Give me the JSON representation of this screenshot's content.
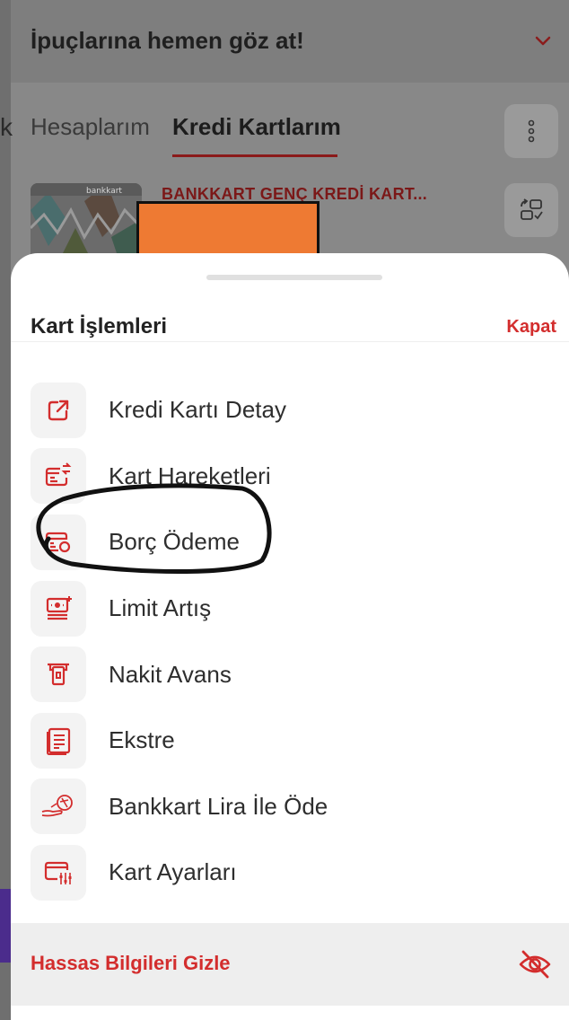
{
  "tips": {
    "title": "İpuçlarına hemen göz at!",
    "chevron_icon": "chevron-down-icon"
  },
  "tabs": [
    {
      "label": "Hesaplarım",
      "active": false
    },
    {
      "label": "Kredi Kartlarım",
      "active": true
    }
  ],
  "card": {
    "name": "BANKKART GENÇ KREDİ KART...",
    "brand_text": "bankkart"
  },
  "sheet": {
    "title": "Kart İşlemleri",
    "close_label": "Kapat",
    "items": [
      {
        "label": "Kredi Kartı Detay",
        "icon": "external-link-icon"
      },
      {
        "label": "Kart Hareketleri",
        "icon": "card-transactions-icon"
      },
      {
        "label": "Borç Ödeme",
        "icon": "debt-payment-icon"
      },
      {
        "label": "Limit Artış",
        "icon": "limit-increase-icon"
      },
      {
        "label": "Nakit Avans",
        "icon": "cash-advance-icon"
      },
      {
        "label": "Ekstre",
        "icon": "statement-icon"
      },
      {
        "label": "Bankkart Lira İle Öde",
        "icon": "bankkart-lira-icon"
      },
      {
        "label": "Kart Ayarları",
        "icon": "card-settings-icon"
      }
    ],
    "footer_label": "Hassas Bilgileri Gizle",
    "footer_icon": "eye-off-icon"
  },
  "colors": {
    "accent_red": "#d32d2d",
    "redaction_orange": "#ee7a33"
  }
}
